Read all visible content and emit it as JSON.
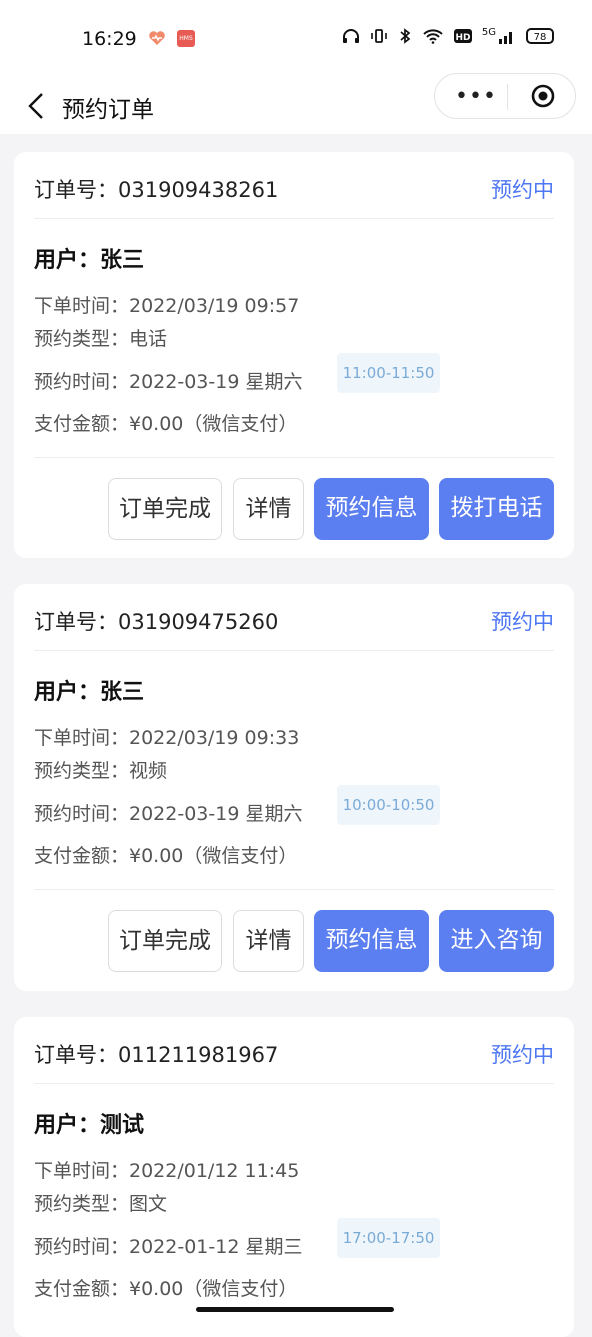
{
  "status_bar": {
    "time": "16:29",
    "app_badge": "HMS",
    "network_label": "5G",
    "battery": "78"
  },
  "nav": {
    "title": "预约订单",
    "more_label": "•••"
  },
  "orders": [
    {
      "order_no": "订单号：031909438261",
      "status": "预约中",
      "user": "用户：张三",
      "order_time": "下单时间：2022/03/19 09:57",
      "appt_type": "预约类型：电话",
      "appt_time": "预约时间：2022-03-19 星期六",
      "slot": "11:00-11:50",
      "payment": "支付金额：¥0.00（微信支付）",
      "btn_complete": "订单完成",
      "btn_detail": "详情",
      "btn_info": "预约信息",
      "btn_action": "拨打电话"
    },
    {
      "order_no": "订单号：031909475260",
      "status": "预约中",
      "user": "用户：张三",
      "order_time": "下单时间：2022/03/19 09:33",
      "appt_type": "预约类型：视频",
      "appt_time": "预约时间：2022-03-19 星期六",
      "slot": "10:00-10:50",
      "payment": "支付金额：¥0.00（微信支付）",
      "btn_complete": "订单完成",
      "btn_detail": "详情",
      "btn_info": "预约信息",
      "btn_action": "进入咨询"
    },
    {
      "order_no": "订单号：011211981967",
      "status": "预约中",
      "user": "用户：测试",
      "order_time": "下单时间：2022/01/12 11:45",
      "appt_type": "预约类型：图文",
      "appt_time": "预约时间：2022-01-12 星期三",
      "slot": "17:00-17:50",
      "payment": "支付金额：¥0.00（微信支付）"
    }
  ],
  "colors": {
    "accent": "#5b7ef0",
    "status_text": "#4e77f4",
    "slot_bg": "#eff6fb",
    "slot_text": "#7aaad6"
  }
}
